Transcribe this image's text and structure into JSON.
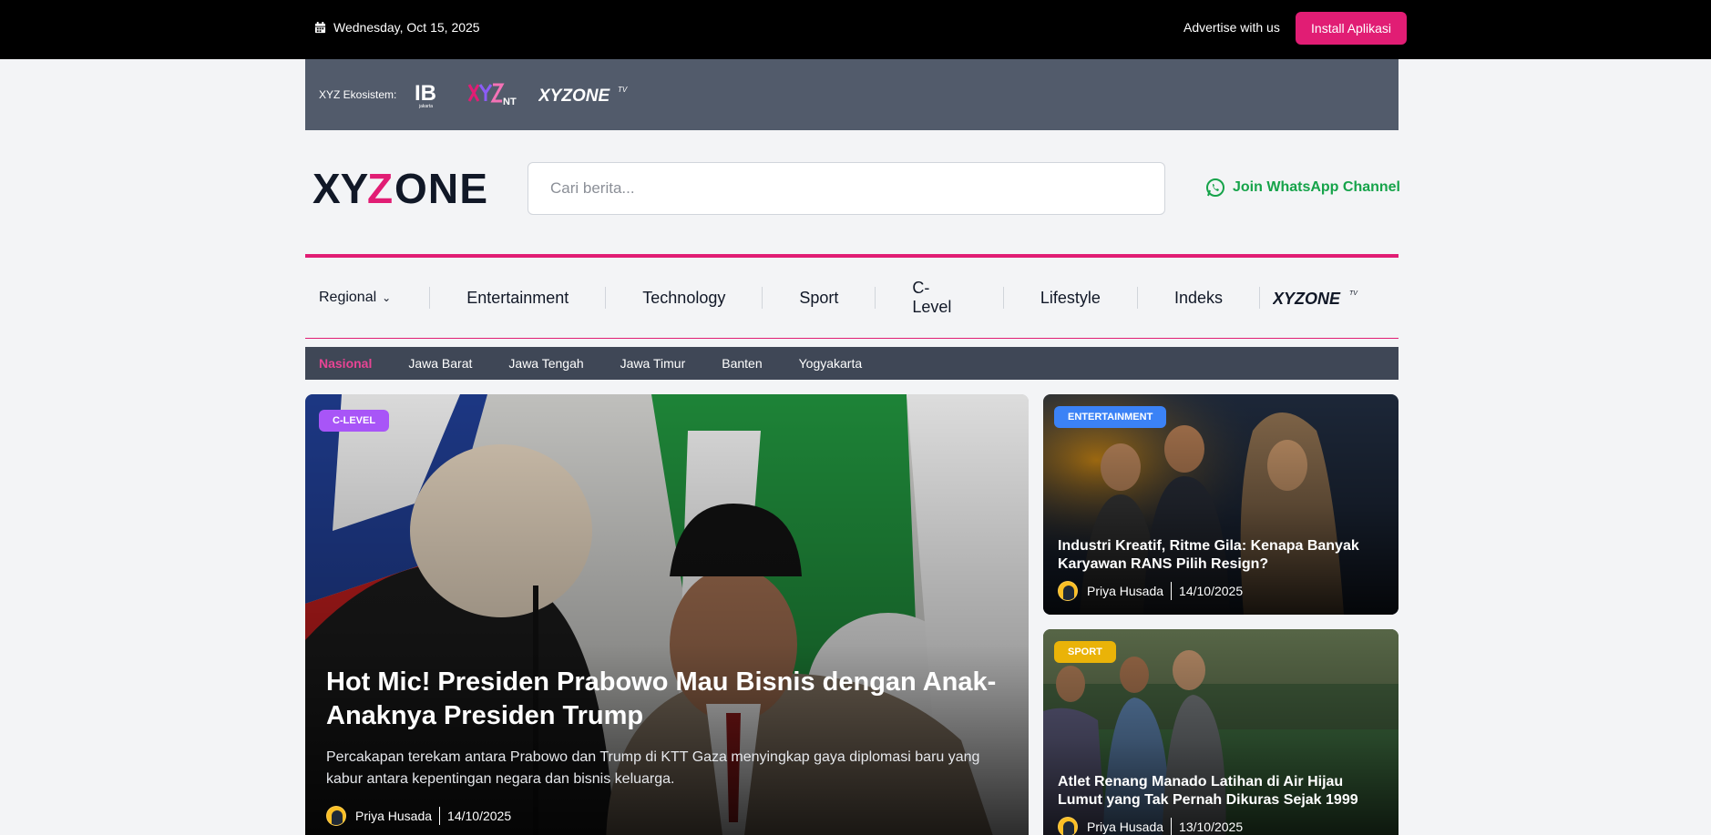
{
  "topbar": {
    "date": "Wednesday, Oct 15, 2025",
    "advertise": "Advertise with us",
    "install_label": "Install Aplikasi"
  },
  "ecosystem": {
    "label": "XYZ Ekosistem:",
    "logos": [
      "IB Jakarta logo",
      "XYZ NT logo",
      "XYZONE TV logo"
    ],
    "logo_text": {
      "tv_word": "XYZONE",
      "tv_suffix": "TV",
      "nt_suffix": "NT",
      "ib_caption": "jakarta"
    }
  },
  "header": {
    "logo_left": "XY",
    "logo_z": "Z",
    "logo_right": "ONE",
    "search_placeholder": "Cari berita...",
    "whatsapp_label": "Join WhatsApp Channel"
  },
  "nav": {
    "items": [
      {
        "label": "Regional"
      },
      {
        "label": "Entertainment"
      },
      {
        "label": "Technology"
      },
      {
        "label": "Sport"
      },
      {
        "label": "C-Level"
      },
      {
        "label": "Lifestyle"
      },
      {
        "label": "Indeks"
      }
    ],
    "tv_logo": {
      "word": "XYZONE",
      "suffix": "TV"
    }
  },
  "subnav": {
    "items": [
      {
        "label": "Nasional",
        "active": true
      },
      {
        "label": "Jawa Barat"
      },
      {
        "label": "Jawa Tengah"
      },
      {
        "label": "Jawa Timur"
      },
      {
        "label": "Banten"
      },
      {
        "label": "Yogyakarta"
      }
    ]
  },
  "hero": {
    "badge": "C-LEVEL",
    "title": "Hot Mic! Presiden Prabowo Mau Bisnis dengan Anak-Anaknya Presiden Trump",
    "excerpt": "Percakapan terekam antara Prabowo dan Trump di KTT Gaza menyingkap gaya diplomasi baru yang kabur antara kepentingan negara dan bisnis keluarga.",
    "author": "Priya Husada",
    "date": "14/10/2025"
  },
  "side_articles": [
    {
      "badge": "ENTERTAINMENT",
      "title": "Industri Kreatif, Ritme Gila: Kenapa Banyak Karyawan RANS Pilih Resign?",
      "author": "Priya Husada",
      "date": "14/10/2025"
    },
    {
      "badge": "SPORT",
      "title": "Atlet Renang Manado Latihan di Air Hijau Lumut yang Tak Pernah Dikuras Sejak 1999",
      "author": "Priya Husada",
      "date": "13/10/2025"
    }
  ],
  "colors": {
    "accent": "#e11d74",
    "whatsapp": "#16a34a",
    "badge_clevel": "#a855f7",
    "badge_entertainment": "#3b82f6",
    "badge_sport": "#eab308"
  }
}
